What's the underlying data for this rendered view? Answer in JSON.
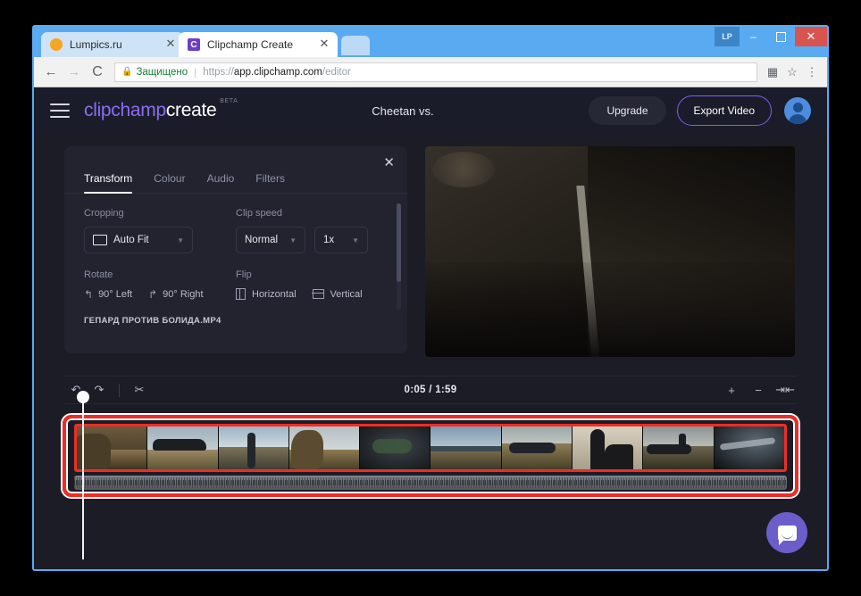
{
  "window": {
    "controls": {
      "lp": "LP",
      "minimize": "–",
      "maximize": "❐",
      "close": "✕"
    }
  },
  "browser": {
    "tabs": [
      {
        "title": "Lumpics.ru",
        "favicon": "orange-dot-icon",
        "active": false,
        "close": "✕"
      },
      {
        "title": "Clipchamp Create",
        "favicon": "clipchamp-c-icon",
        "favicon_letter": "C",
        "active": true,
        "close": "✕"
      }
    ],
    "toolbar": {
      "back": "←",
      "forward": "→",
      "reload": "⟳",
      "secure_label": "Защищено",
      "url_scheme": "https://",
      "url_host": "app.clipchamp.com",
      "url_path": "/editor",
      "translate_icon": "translate-icon",
      "bookmark_icon": "star-icon",
      "menu_icon": "kebab-menu-icon"
    }
  },
  "app": {
    "header": {
      "menu_icon": "hamburger-menu-icon",
      "logo_part1": "clipchamp",
      "logo_part2": "create",
      "logo_badge": "BETA",
      "project_title": "Cheetan vs.",
      "upgrade_label": "Upgrade",
      "export_label": "Export Video",
      "avatar": "user-avatar"
    },
    "properties_panel": {
      "close": "✕",
      "tabs": [
        {
          "label": "Transform",
          "active": true
        },
        {
          "label": "Colour",
          "active": false
        },
        {
          "label": "Audio",
          "active": false
        },
        {
          "label": "Filters",
          "active": false
        }
      ],
      "cropping_label": "Cropping",
      "cropping_value": "Auto Fit",
      "clip_speed_label": "Clip speed",
      "clip_speed_value": "Normal",
      "clip_speed_multiplier": "1x",
      "rotate_label": "Rotate",
      "rotate_left": "90° Left",
      "rotate_right": "90° Right",
      "flip_label": "Flip",
      "flip_horizontal": "Horizontal",
      "flip_vertical": "Vertical",
      "filename": "ГЕПАРД ПРОТИВ БОЛИДА.MP4"
    },
    "preview": {
      "name": "video-preview"
    },
    "timeline_toolbar": {
      "undo": "undo-icon",
      "redo": "redo-icon",
      "split": "scissors-icon",
      "timecode": "0:05 / 1:59",
      "zoom_in": "+",
      "zoom_out": "−",
      "fit": "fit-icon"
    },
    "timeline": {
      "clip_count": 10,
      "selected": true,
      "audio_track": "audio-waveform-track"
    },
    "chat": {
      "label": "intercom-chat-bubble"
    }
  },
  "colors": {
    "accent_purple": "#8b6df0",
    "export_border": "#7b5ff0",
    "selection_red": "#ee2d24",
    "app_bg": "#1b1c26",
    "panel_bg": "#22232f",
    "browser_blue": "#5aaaf2",
    "chat_purple": "#6b5ecb"
  }
}
